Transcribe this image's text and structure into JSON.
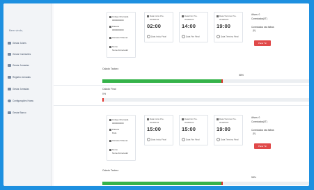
{
  "colors": {
    "background": "#1e90e0",
    "progress": "#35b34a",
    "alert": "#e0322d",
    "stop_button": "#e04a4a"
  },
  "sidebar": {
    "header": "Bem vindo,",
    "items": [
      {
        "icon": "user-icon",
        "label": "Gestor Juízes"
      },
      {
        "icon": "user-icon",
        "label": "Gestor Comissões"
      },
      {
        "icon": "list-icon",
        "label": "Gestor Jornadas"
      },
      {
        "icon": "table-icon",
        "label": "Registro Jornadas"
      },
      {
        "icon": "chart-icon",
        "label": "Gestor Jornadas"
      },
      {
        "icon": "gear-icon",
        "label": "Configurações Horas"
      },
      {
        "icon": "book-icon",
        "label": "Gestor Banco"
      }
    ]
  },
  "blocks": [
    {
      "card1": {
        "line1": "Código Chamada",
        "line2": "0000000000",
        "line3": "Palavra",
        "line4": "0000000000",
        "line5": "Câmara Tribunal",
        "line6": "Nome",
        "line7": "Nome fornecedor"
      },
      "card2": {
        "label": "Data Início Pre.",
        "date": "2018/04/4",
        "time": "02:00",
        "radio": "Data Início Final"
      },
      "card3": {
        "label": "Data Fim Pre.",
        "date": "2018/04/4",
        "time": "14:00",
        "radio": "Data Fim Final"
      },
      "card4": {
        "label": "Data Término Pre.",
        "date": "2018/04/4",
        "time": "19:00",
        "radio": "Data Término Final"
      },
      "info": {
        "status": "Ativos: 0",
        "connected": "Conectados(0T)",
        "note": "Conectados nas falhas",
        "sub": "(0)"
      },
      "stop_label": "Parar Tic",
      "progress1": {
        "label": "Calado Taclaro",
        "pct_text": "58%",
        "value": 58
      },
      "progress2": {
        "label": "Calado Final",
        "pct_text": "0%",
        "value": 0
      }
    },
    {
      "card1": {
        "line1": "Código Chamada",
        "line2": "0000000000",
        "line3": "Palavra",
        "line4": "Data",
        "line5": "Câmara Tribunal",
        "line6": "Nome",
        "line7": "Nome fornecedor"
      },
      "card2": {
        "label": "Data Início Pre.",
        "date": "2018/04/4",
        "time": "15:00",
        "radio": "Data Início Final"
      },
      "card3": {
        "label": "Data Fim Pre.",
        "date": "2018/04/4",
        "time": "15:00",
        "radio": "Data Fim Final"
      },
      "card4": {
        "label": "Data Término Pre.",
        "date": "2018/04/4",
        "time": "19:00",
        "radio": "Data Término Final"
      },
      "info": {
        "status": "Ativos: 0",
        "connected": "Conectados(0T)",
        "note": "Conectados nas falhas",
        "sub": "(0)"
      },
      "stop_label": "Parar Tic",
      "progress1": {
        "label": "Calado Taclaro",
        "pct_text": "58%",
        "value": 58
      }
    }
  ]
}
